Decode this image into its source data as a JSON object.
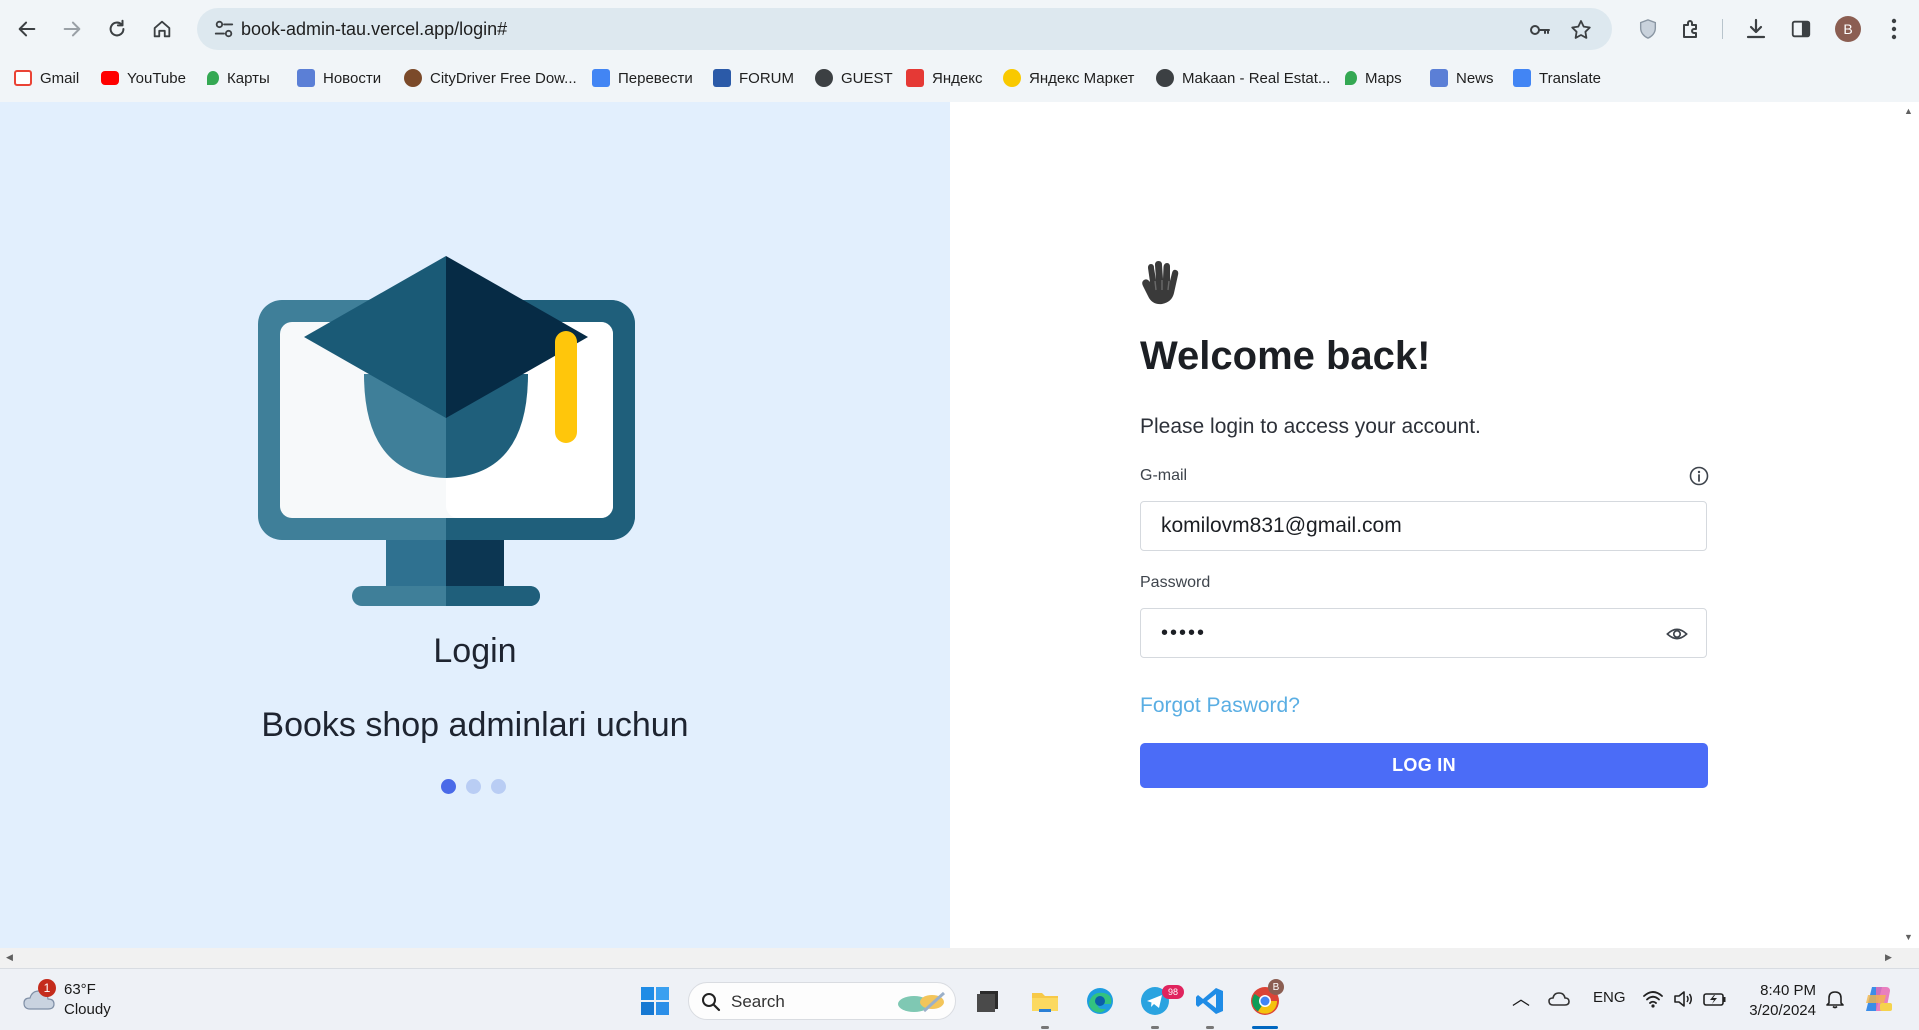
{
  "browser": {
    "url": "book-admin-tau.vercel.app/login#",
    "avatar_letter": "B",
    "bookmarks": [
      {
        "label": "Gmail",
        "icon": "gmail-icon",
        "color": "#ea4335"
      },
      {
        "label": "YouTube",
        "icon": "youtube-icon",
        "color": "#ff0000"
      },
      {
        "label": "Карты",
        "icon": "maps-pin-icon",
        "color": "#34a853"
      },
      {
        "label": "Новости",
        "icon": "news-icon",
        "color": "#5b7fd6"
      },
      {
        "label": "CityDriver Free Dow...",
        "icon": "citydriver-icon",
        "color": "#7b4a2a"
      },
      {
        "label": "Перевести",
        "icon": "translate-icon",
        "color": "#4285f4"
      },
      {
        "label": "FORUM",
        "icon": "forum-icon",
        "color": "#2b5aa8"
      },
      {
        "label": "GUEST",
        "icon": "globe-icon",
        "color": "#3c4043"
      },
      {
        "label": "Яндекс",
        "icon": "yandex-icon",
        "color": "#e53935"
      },
      {
        "label": "Яндекс Маркет",
        "icon": "yandex-market-icon",
        "color": "#f9c900"
      },
      {
        "label": "Makaan - Real Estat...",
        "icon": "globe-icon",
        "color": "#3c4043"
      },
      {
        "label": "Maps",
        "icon": "maps-pin-icon",
        "color": "#34a853"
      },
      {
        "label": "News",
        "icon": "news-icon",
        "color": "#5b7fd6"
      },
      {
        "label": "Translate",
        "icon": "translate-icon",
        "color": "#4285f4"
      }
    ]
  },
  "left": {
    "title": "Login",
    "subtitle": "Books shop adminlari uchun",
    "slides": 3,
    "active_slide": 0
  },
  "form": {
    "welcome": "Welcome back!",
    "prompt": "Please login to access your account.",
    "email_label": "G-mail",
    "email_value": "komilovm831@gmail.com",
    "password_label": "Password",
    "password_mask": "•••••",
    "forgot_label": "Forgot Pasword?",
    "login_label": "LOG IN",
    "accent_color": "#4b6cf7"
  },
  "taskbar": {
    "weather_badge": "1",
    "temperature": "63°F",
    "condition": "Cloudy",
    "search_label": "Search",
    "telegram_badge": "98",
    "chrome_badge": "B",
    "language": "ENG",
    "time": "8:40 PM",
    "date": "3/20/2024"
  }
}
